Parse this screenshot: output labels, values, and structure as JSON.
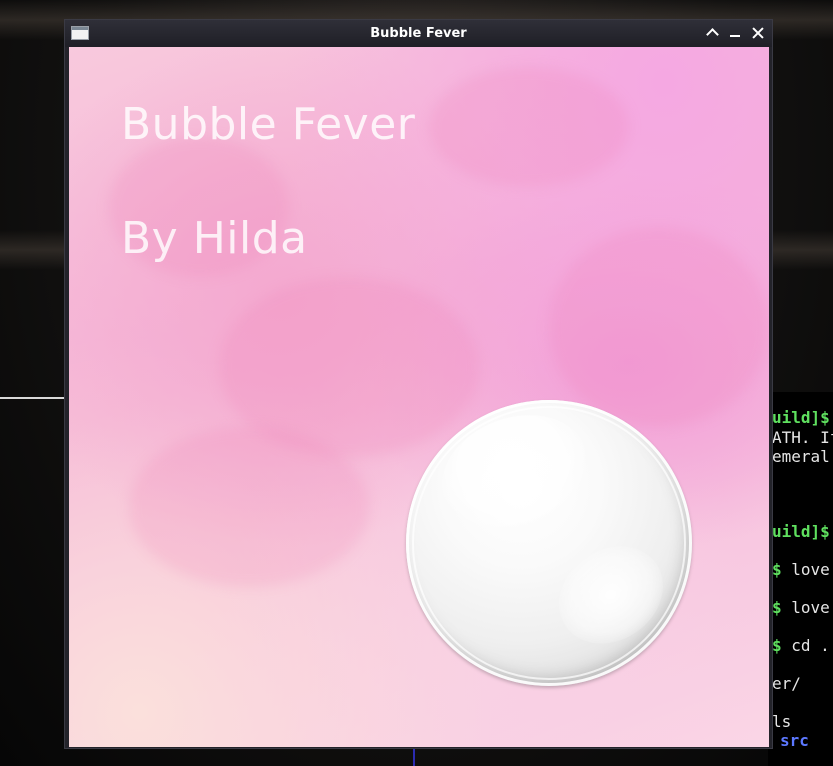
{
  "window": {
    "title": "Bubble Fever",
    "buttons": [
      "maximize",
      "minimize",
      "close"
    ]
  },
  "game": {
    "title": "Bubble Fever",
    "author": "By Hilda",
    "bubble_icon": "bubble"
  },
  "terminal": {
    "lines": [
      {
        "text": "uild]$",
        "style": "green"
      },
      {
        "text": "ATH. If",
        "style": "plain"
      },
      {
        "text": "emeral",
        "style": "plain"
      },
      {
        "text": "uild]$",
        "style": "green"
      },
      {
        "text": "$ love",
        "style": "mixed"
      },
      {
        "text": "$ love",
        "style": "mixed"
      },
      {
        "text": "$ cd .",
        "style": "mixed"
      },
      {
        "text": "er/",
        "style": "plain"
      },
      {
        "text": "ls",
        "style": "plain"
      },
      {
        "text": "src",
        "style": "blue"
      }
    ]
  },
  "colors": {
    "titlebar": "#23232a",
    "bubble": "#f2f2f2",
    "background_pink": "#f5b4d6",
    "terminal_prompt": "#5fe05f",
    "terminal_dir": "#5c78ff"
  }
}
